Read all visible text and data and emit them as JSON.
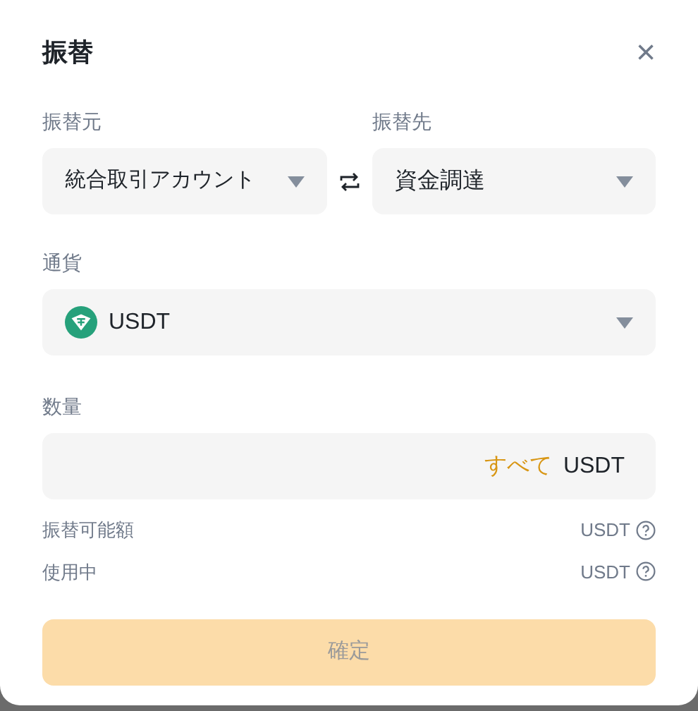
{
  "dialog": {
    "title": "振替",
    "close": "×"
  },
  "from": {
    "label": "振替元",
    "value": "統合取引アカウント"
  },
  "to": {
    "label": "振替先",
    "value": "資金調達"
  },
  "currency": {
    "label": "通貨",
    "value": "USDT"
  },
  "amount": {
    "label": "数量",
    "all": "すべて",
    "unit": "USDT"
  },
  "info_rows": [
    {
      "label": "振替可能額",
      "value": "USDT"
    },
    {
      "label": "使用中",
      "value": "USDT"
    }
  ],
  "confirm": {
    "label": "確定",
    "disabled": true
  }
}
